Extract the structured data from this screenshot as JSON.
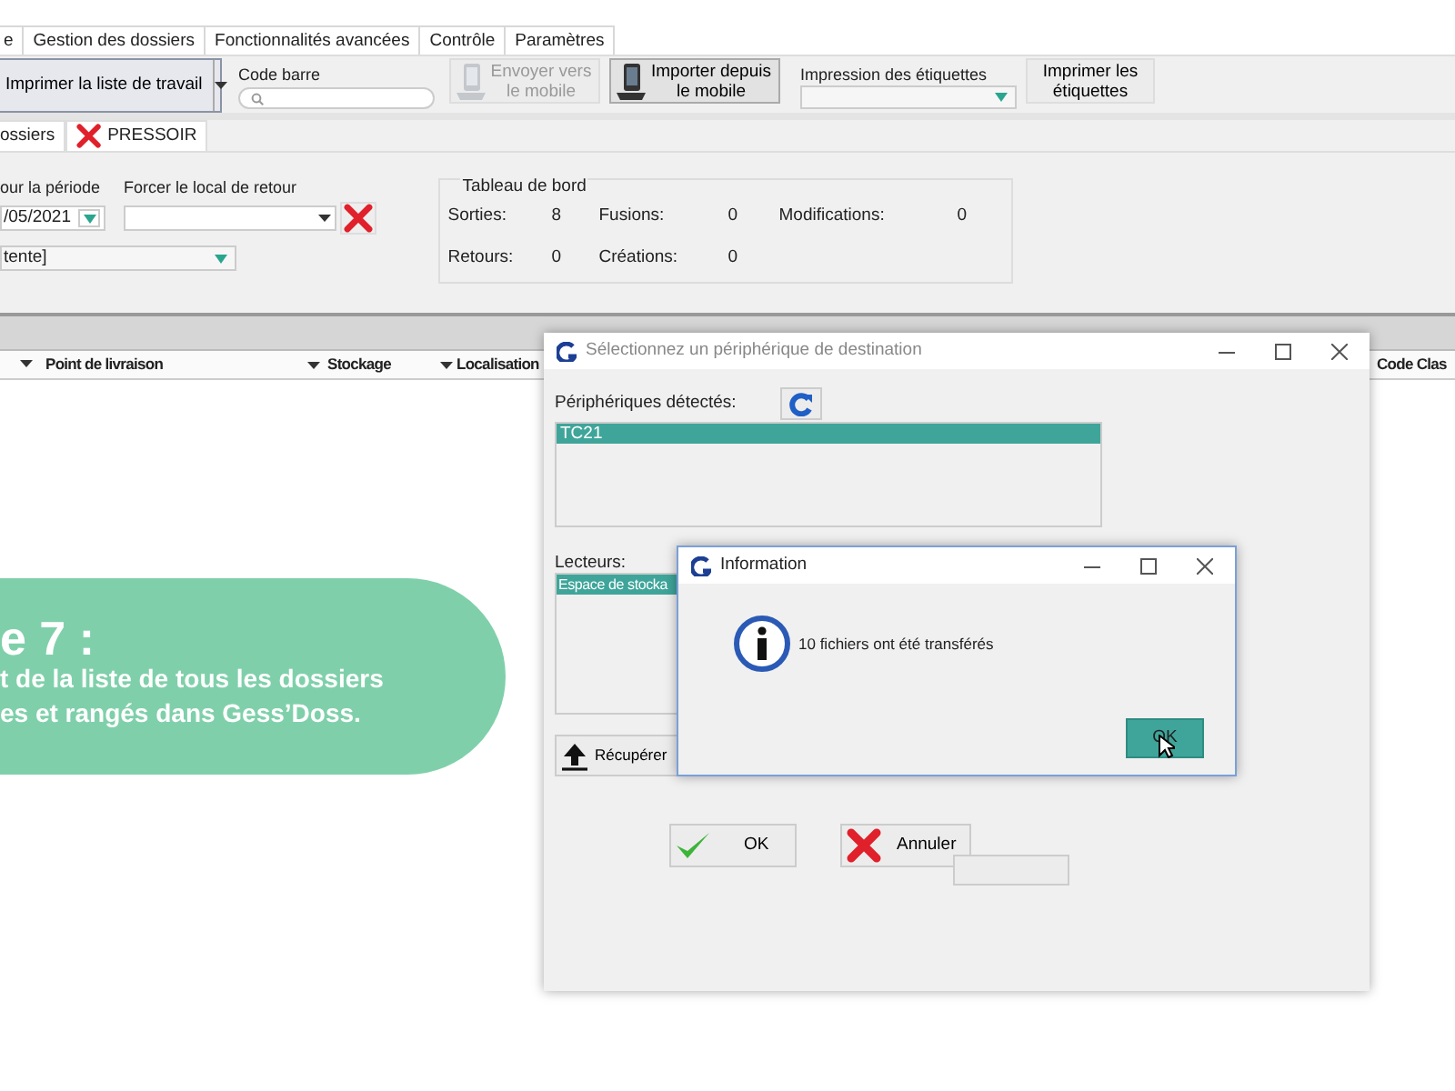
{
  "menu_tabs": [
    {
      "label": "e"
    },
    {
      "label": "Gestion des dossiers"
    },
    {
      "label": "Fonctionnalités avancées"
    },
    {
      "label": "Contrôle"
    },
    {
      "label": "Paramètres"
    }
  ],
  "toolbar": {
    "print_worklist": "Imprimer la liste de travail",
    "barcode_label": "Code barre",
    "mobile_buttons": [
      {
        "label": "Envoyer vers le mobile",
        "disabled": true
      },
      {
        "label": "Importer depuis le mobile",
        "disabled": false
      }
    ],
    "labels_print_label": "Impression des étiquettes",
    "print_labels_button": "Imprimer les étiquettes"
  },
  "doc_tabs": [
    {
      "label": "ossiers",
      "kind": "plain"
    },
    {
      "label": "PRESSOIR",
      "kind": "closable"
    }
  ],
  "filters": {
    "period_label": "our la période",
    "date_value": "/05/2021",
    "return_label": "Forcer le local de retour",
    "status_value": "tente]"
  },
  "dashboard": {
    "title": "Tableau de bord",
    "stats": [
      {
        "label": "Sorties:",
        "value": "8"
      },
      {
        "label": "Fusions:",
        "value": "0"
      },
      {
        "label": "Modifications:",
        "value": "0"
      },
      {
        "label": "Retours:",
        "value": "0"
      },
      {
        "label": "Créations:",
        "value": "0"
      }
    ]
  },
  "table": {
    "columns": [
      "Point de livraison",
      "Stockage",
      "Localisation",
      "Code Clas"
    ]
  },
  "callout": {
    "heading": "e 7 :",
    "lines": [
      "t de la liste de tous les dossiers",
      "es et rangés dans Gess’Doss."
    ]
  },
  "device_dialog": {
    "title": "Sélectionnez un périphérique de destination",
    "detected_label": "Périphériques détectés:",
    "devices": [
      {
        "label": "TC21",
        "selected": true
      }
    ],
    "readers_label": "Lecteurs:",
    "readers": [
      {
        "label": "Espace de stocka",
        "selected": true
      }
    ],
    "retrieve_button": "Récupérer",
    "ok_button": "OK",
    "cancel_button": "Annuler"
  },
  "info_dialog": {
    "title": "Information",
    "message": "10 fichiers ont été transférés",
    "ok_button": "OK"
  }
}
